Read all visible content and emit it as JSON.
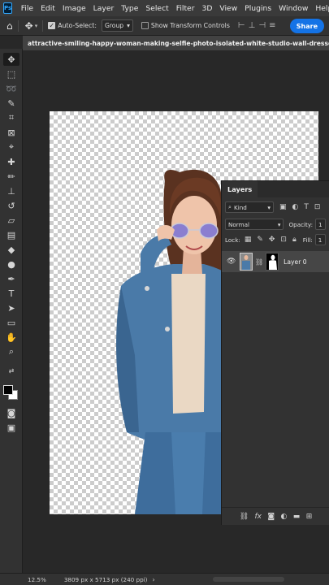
{
  "menubar": {
    "logo": "Ps",
    "items": [
      "File",
      "Edit",
      "Image",
      "Layer",
      "Type",
      "Select",
      "Filter",
      "3D",
      "View",
      "Plugins",
      "Window",
      "Help"
    ]
  },
  "options": {
    "auto_select_label": "Auto-Select:",
    "auto_select_value": "Group",
    "show_transform_label": "Show Transform Controls",
    "share_label": "Share"
  },
  "document": {
    "title": "attractive-smiling-happy-woman-making-selfie-photo-isolated-white-studio-wall-dressed-jeans-denim"
  },
  "layers_panel": {
    "tab_label": "Layers",
    "filter_kind": "Kind",
    "blend_mode": "Normal",
    "opacity_label": "Opacity:",
    "opacity_value": "1",
    "lock_label": "Lock:",
    "fill_label": "Fill:",
    "fill_value": "1",
    "layer_name": "Layer 0"
  },
  "status": {
    "zoom": "12.5%",
    "doc_info": "3809 px x 5713 px (240 ppi)"
  },
  "colors": {
    "accent": "#1473e6",
    "ps_blue": "#31a8ff"
  }
}
